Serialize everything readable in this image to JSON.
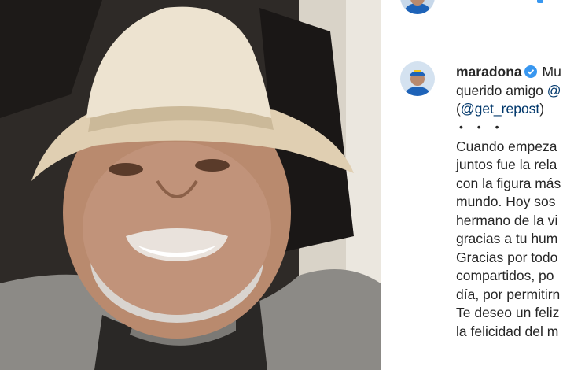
{
  "post": {
    "username": "maradona",
    "caption_lines": [
      "Mu",
      "querido amigo"
    ],
    "mention_partial": "@",
    "repost_open": "(",
    "repost_handle": "@get_repost",
    "repost_close": ")",
    "dots": "• • •",
    "body_lines": [
      "Cuando empeza",
      "juntos fue la rela",
      "con la figura más",
      "mundo. Hoy sos",
      "hermano de la vi",
      "gracias a tu hum",
      "Gracias por todo",
      "compartidos, po",
      "día, por permitirn",
      "Te deseo un feliz",
      "la felicidad del m"
    ]
  },
  "colors": {
    "verified_badge": "#3897f0",
    "mention": "#00376b",
    "text": "#262626"
  },
  "icons": {
    "verified": "verified-badge-icon"
  }
}
